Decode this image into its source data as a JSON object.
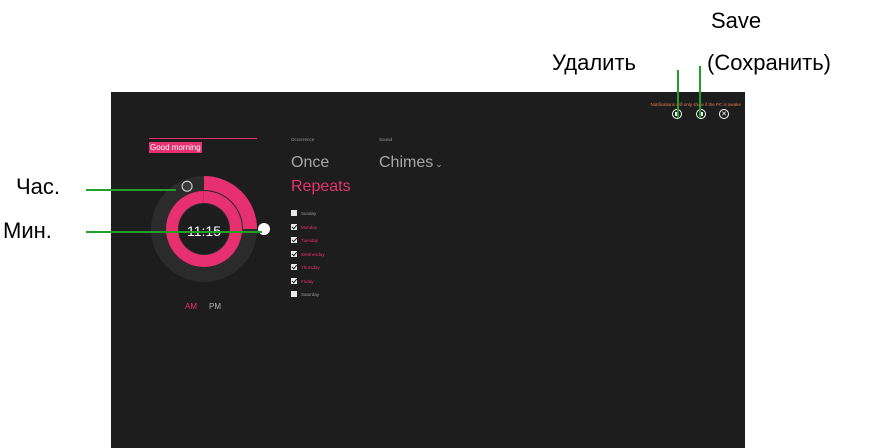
{
  "annotations": {
    "save_line1": "Save",
    "save_line2": "(Сохранить)",
    "delete": "Удалить",
    "hour": "Час.",
    "minute": "Мин."
  },
  "alarm": {
    "notice": "Notifications will only show if the PC is awake",
    "title_value": "Good morning",
    "time_display": "11:15",
    "am_label": "AM",
    "pm_label": "PM",
    "selected_period": "AM",
    "occurrence": {
      "label": "Occurrence",
      "options": [
        "Once",
        "Repeats"
      ],
      "selected": "Repeats"
    },
    "sound": {
      "label": "Sound",
      "value": "Chimes",
      "chevron": "⌄"
    },
    "days": [
      {
        "name": "Sunday",
        "checked": false
      },
      {
        "name": "Monday",
        "checked": true
      },
      {
        "name": "Tuesday",
        "checked": true
      },
      {
        "name": "Wednesday",
        "checked": true
      },
      {
        "name": "Thursday",
        "checked": true
      },
      {
        "name": "Friday",
        "checked": true
      },
      {
        "name": "Saturday",
        "checked": false
      }
    ],
    "hour_progress": 0.32,
    "minute_progress": 0.25,
    "close_symbol": "✕"
  },
  "colors": {
    "accent": "#e6306f",
    "background": "#1d1d1d",
    "notice": "#e8794a",
    "callout_line": "#22a02a"
  },
  "icons": [
    "delete-icon",
    "save-icon",
    "close-icon"
  ]
}
